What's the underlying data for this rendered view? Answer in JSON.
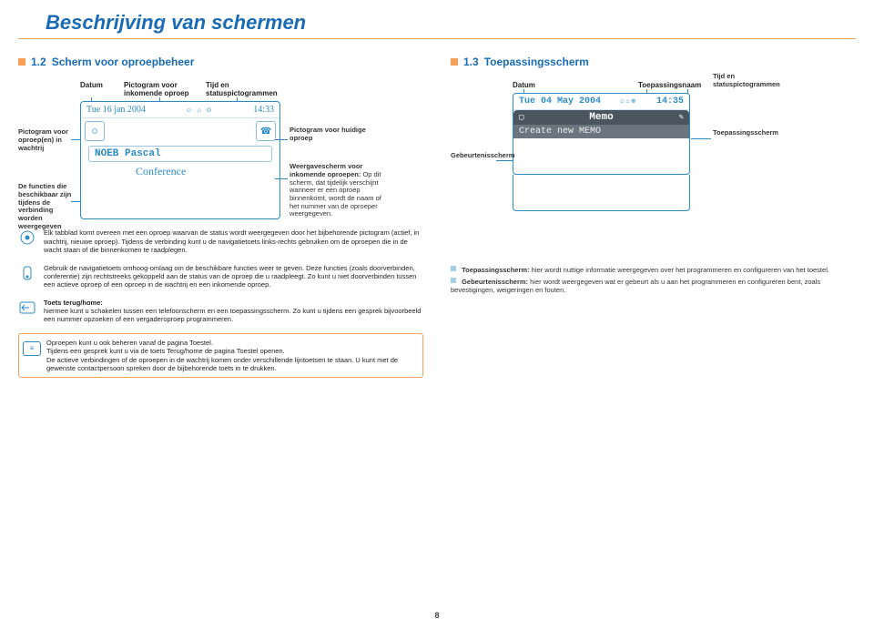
{
  "page_title": "Beschrijving van schermen",
  "page_number": "8",
  "left": {
    "section_num": "1.2",
    "section_title": "Scherm voor oproepbeheer",
    "top_labels": {
      "datum": "Datum",
      "pict_in": "Pictogram voor inkomende oproep",
      "tijd_status": "Tijd en statuspictogrammen"
    },
    "screen": {
      "date": "Tue 16 jan 2004",
      "time": "14:33",
      "noeb": "NOEB Pascal",
      "conference": "Conference"
    },
    "left_labels": {
      "wachtrij": "Pictogram voor oproep(en) in wachtrij",
      "functies": "De functies die beschikbaar zijn tijdens de verbinding worden weergegeven"
    },
    "right_labels": {
      "huidige": "Pictogram voor huidige oproep",
      "weergave": "Weergavescherm voor inkomende oproepen:",
      "weergave_desc": "Op dit scherm, dat tijdelijk verschijnt wanneer er een oproep binnenkomt, wordt de naam of het nummer van de oproeper weergegeven."
    },
    "help": {
      "p1": "Elk tabblad komt overeen met een oproep waarvan de status wordt weergegeven door het bijbehorende pictogram (actief, in wachtrij, nieuwe oproep). Tijdens de verbinding kunt u de navigatietoets links-rechts gebruiken om de oproepen die in de wacht staan of die binnenkomen te raadplegen.",
      "p2": "Gebruik de navigatietoets omhoog-omlaag om de beschikbare functies weer te geven. Deze functies (zoals doorverbinden, conferentie) zijn rechtstreeks gekoppeld aan de status van de oproep die u raadpleegt. Zo kunt u niet doorverbinden tussen een actieve oproep of een oproep in de wachtrij en een inkomende oproep.",
      "p3_title": "Toets terug/home:",
      "p3": "hiermee kunt u schakelen tussen een telefoonscherm en een toepassingsscherm. Zo kunt u tijdens een gesprek bijvoorbeeld een nummer opzoeken of een vergaderoproep programmeren."
    },
    "orange": {
      "l1": "Oproepen kunt u ook beheren vanaf de pagina Toestel.",
      "l2": "Tijdens een gesprek kunt u via de toets Terug/home de pagina Toestel openen.",
      "l3": "De actieve verbindingen of de oproepen in de wachtrij komen onder verschillende lijntoetsen te staan. U kunt met de gewenste contactpersoon spreken door de bijbehorende toets in te drukken."
    }
  },
  "right": {
    "section_num": "1.3",
    "section_title": "Toepassingsscherm",
    "top_labels": {
      "datum": "Datum",
      "toepassing": "Toepassingsnaam",
      "tijd_status": "Tijd en statuspictogrammen"
    },
    "screen": {
      "date": "Tue 04 May 2004",
      "time": "14:35",
      "memo": "Memo",
      "create": "Create new MEMO"
    },
    "right_labels": {
      "gebeurtenis": "Gebeurtenisscherm",
      "toepassings": "Toepassingsscherm"
    },
    "info": {
      "p1_b": "Toepassingsscherm:",
      "p1": " hier wordt nuttige informatie weergegeven over het programmeren en configureren van het toestel.",
      "p2_b": "Gebeurtenisscherm:",
      "p2": " hier wordt weergegeven wat er gebeurt als u aan het programmeren en configureren bent, zoals bevestigingen, weigeringen en fouten."
    }
  }
}
